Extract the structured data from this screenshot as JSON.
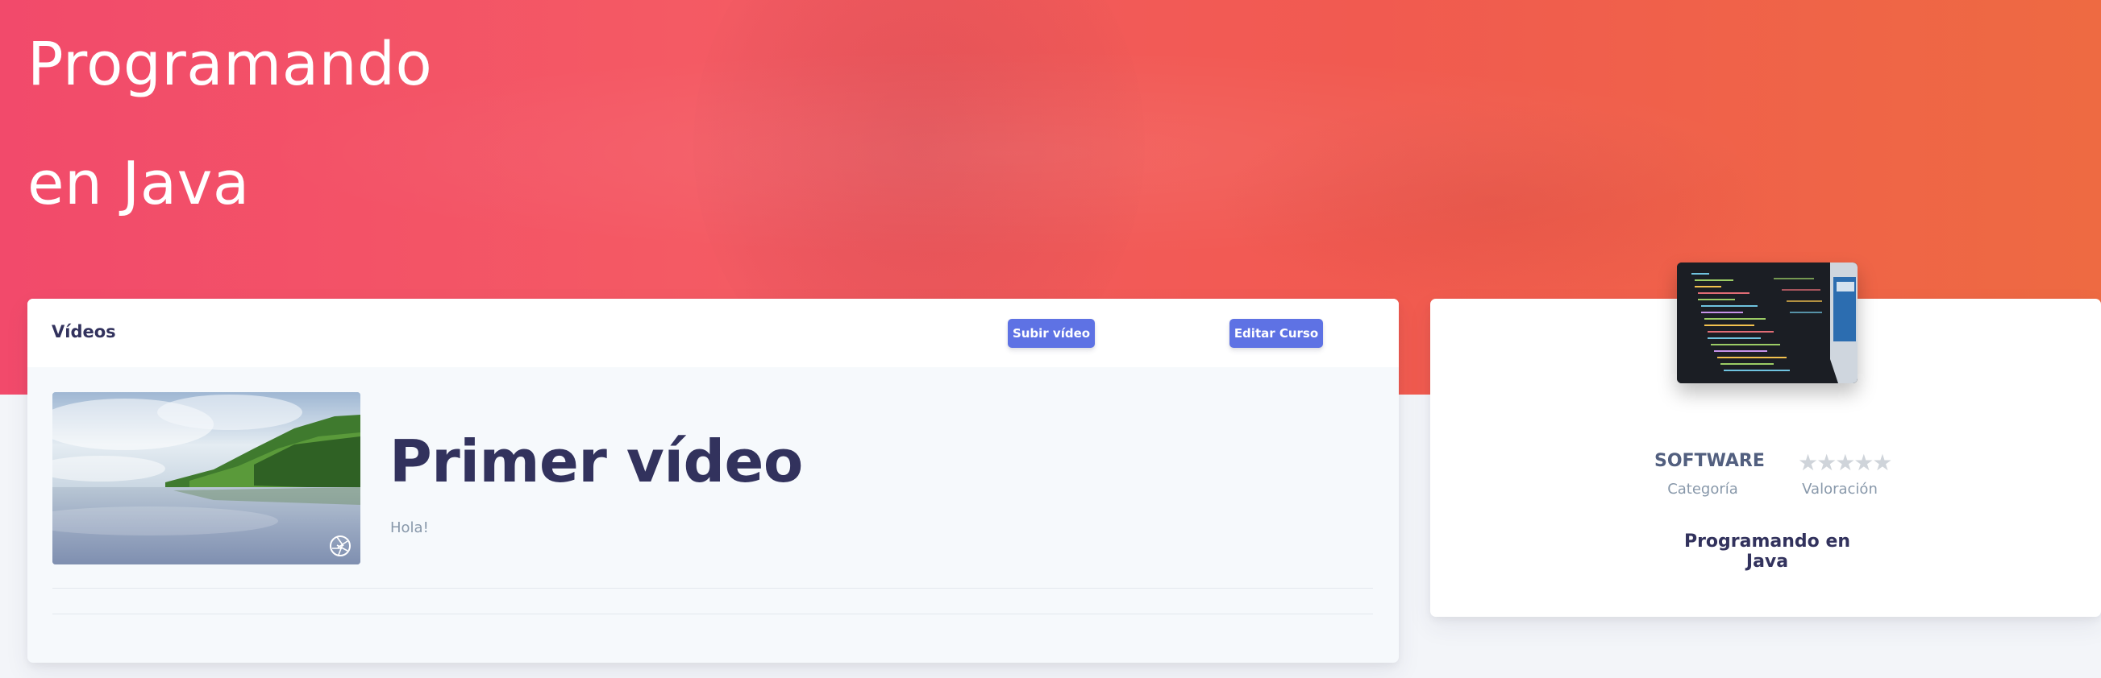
{
  "hero": {
    "title_line1": "Programando",
    "title_line2": "en Java"
  },
  "videos_card": {
    "title": "Vídeos",
    "upload_button": "Subir vídeo",
    "edit_button": "Editar Curso",
    "items": [
      {
        "title": "Primer vídeo",
        "description": "Hola!",
        "thumbnail_icon": "aperture-icon"
      }
    ]
  },
  "course_card": {
    "category_value": "SOFTWARE",
    "category_label": "Categoría",
    "rating_stars": "★★★★★",
    "rating_value": 0,
    "rating_max": 5,
    "rating_label": "Valoración",
    "course_name": "Programando en Java"
  },
  "colors": {
    "hero_gradient_start": "#f24a6b",
    "hero_gradient_end": "#ee6a42",
    "primary_button": "#5e72e4",
    "heading": "#32325d",
    "muted": "#8898aa",
    "star_empty": "#cfd4da"
  }
}
